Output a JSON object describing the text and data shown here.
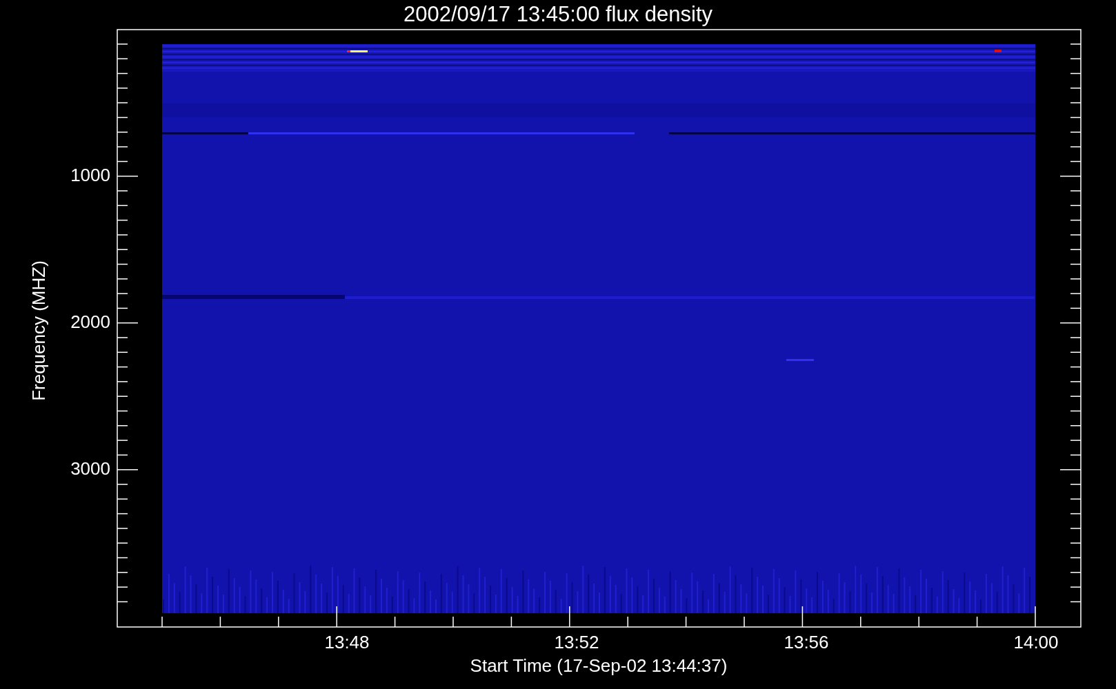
{
  "title": "2002/09/17 13:45:00 flux density",
  "y_axis": {
    "label": "Frequency (MHZ)",
    "tick_labels": [
      "1000",
      "2000",
      "3000"
    ]
  },
  "x_axis": {
    "label": "Start Time (17-Sep-02 13:44:37)",
    "tick_labels": [
      "13:48",
      "13:52",
      "13:56",
      "14:00"
    ]
  }
}
